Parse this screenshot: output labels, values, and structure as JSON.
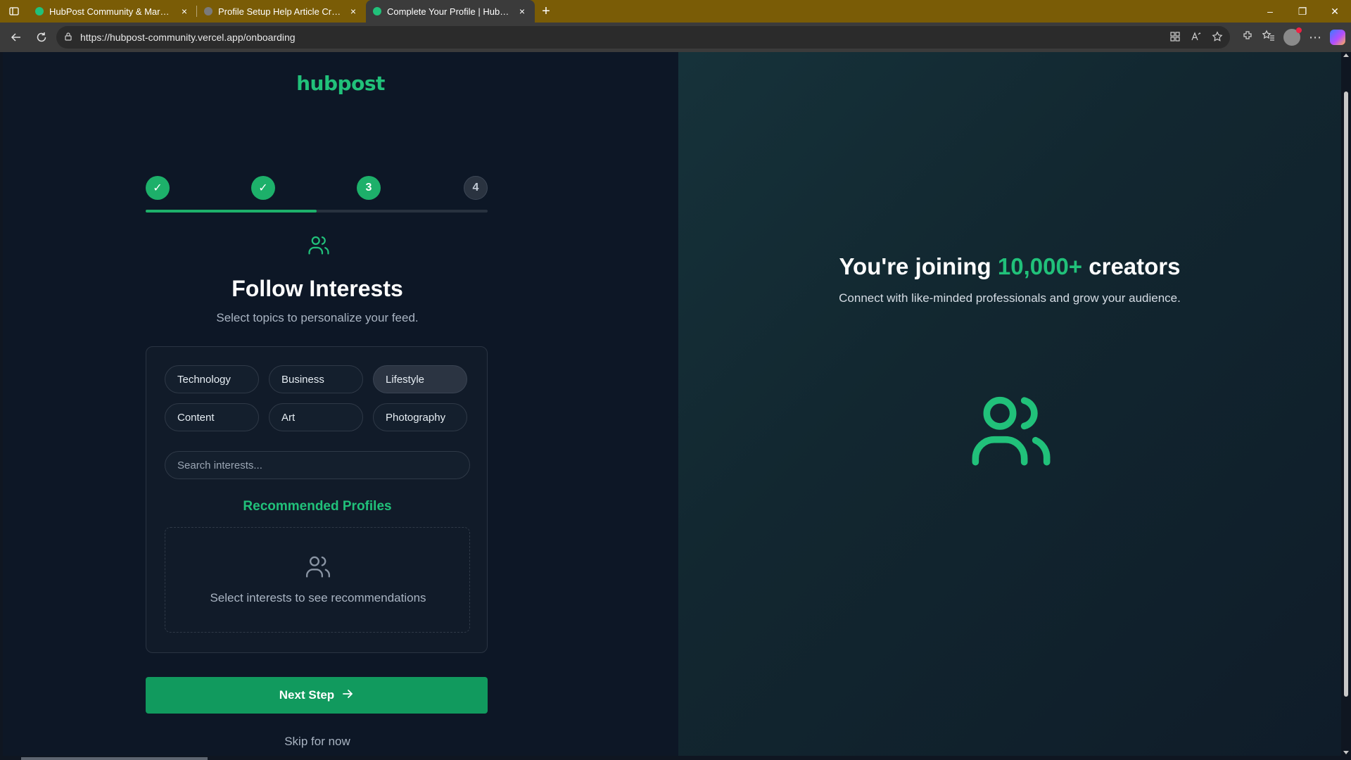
{
  "browser": {
    "tabs": [
      {
        "title": "HubPost Community & Marketpl",
        "active": false,
        "favicon_color": "#21c17a"
      },
      {
        "title": "Profile Setup Help Article Creatio",
        "active": false,
        "favicon_color": "#7a7a7a"
      },
      {
        "title": "Complete Your Profile | HubPost C",
        "active": true,
        "favicon_color": "#21c17a"
      }
    ],
    "new_tab_label": "+",
    "url": "https://hubpost-community.vercel.app/onboarding",
    "tab_close_label": "×",
    "window": {
      "minimize": "–",
      "restore": "❐",
      "close": "✕"
    }
  },
  "page": {
    "logo": "hubpost",
    "stepper": {
      "steps": [
        {
          "label": "✓",
          "state": "done"
        },
        {
          "label": "✓",
          "state": "done"
        },
        {
          "label": "3",
          "state": "current"
        },
        {
          "label": "4",
          "state": "pending"
        }
      ],
      "progress_percent": 50
    },
    "title": "Follow Interests",
    "subtitle": "Select topics to personalize your feed.",
    "interests": [
      {
        "label": "Technology",
        "selected": false
      },
      {
        "label": "Business",
        "selected": false
      },
      {
        "label": "Lifestyle",
        "selected": true
      },
      {
        "label": "Content",
        "selected": false
      },
      {
        "label": "Art",
        "selected": false
      },
      {
        "label": "Photography",
        "selected": false
      }
    ],
    "search": {
      "placeholder": "Search interests...",
      "value": ""
    },
    "recommended_title": "Recommended Profiles",
    "recommended_empty": "Select interests to see recommendations",
    "next_button": "Next Step",
    "skip_link": "Skip for now",
    "hero": {
      "title_pre": "You're joining ",
      "title_accent": "10,000+",
      "title_post": " creators",
      "subtitle": "Connect with like-minded professionals and grow your audience."
    }
  },
  "colors": {
    "accent": "#21c17a",
    "button": "#119a5e",
    "tabbar": "#7a5c06"
  }
}
